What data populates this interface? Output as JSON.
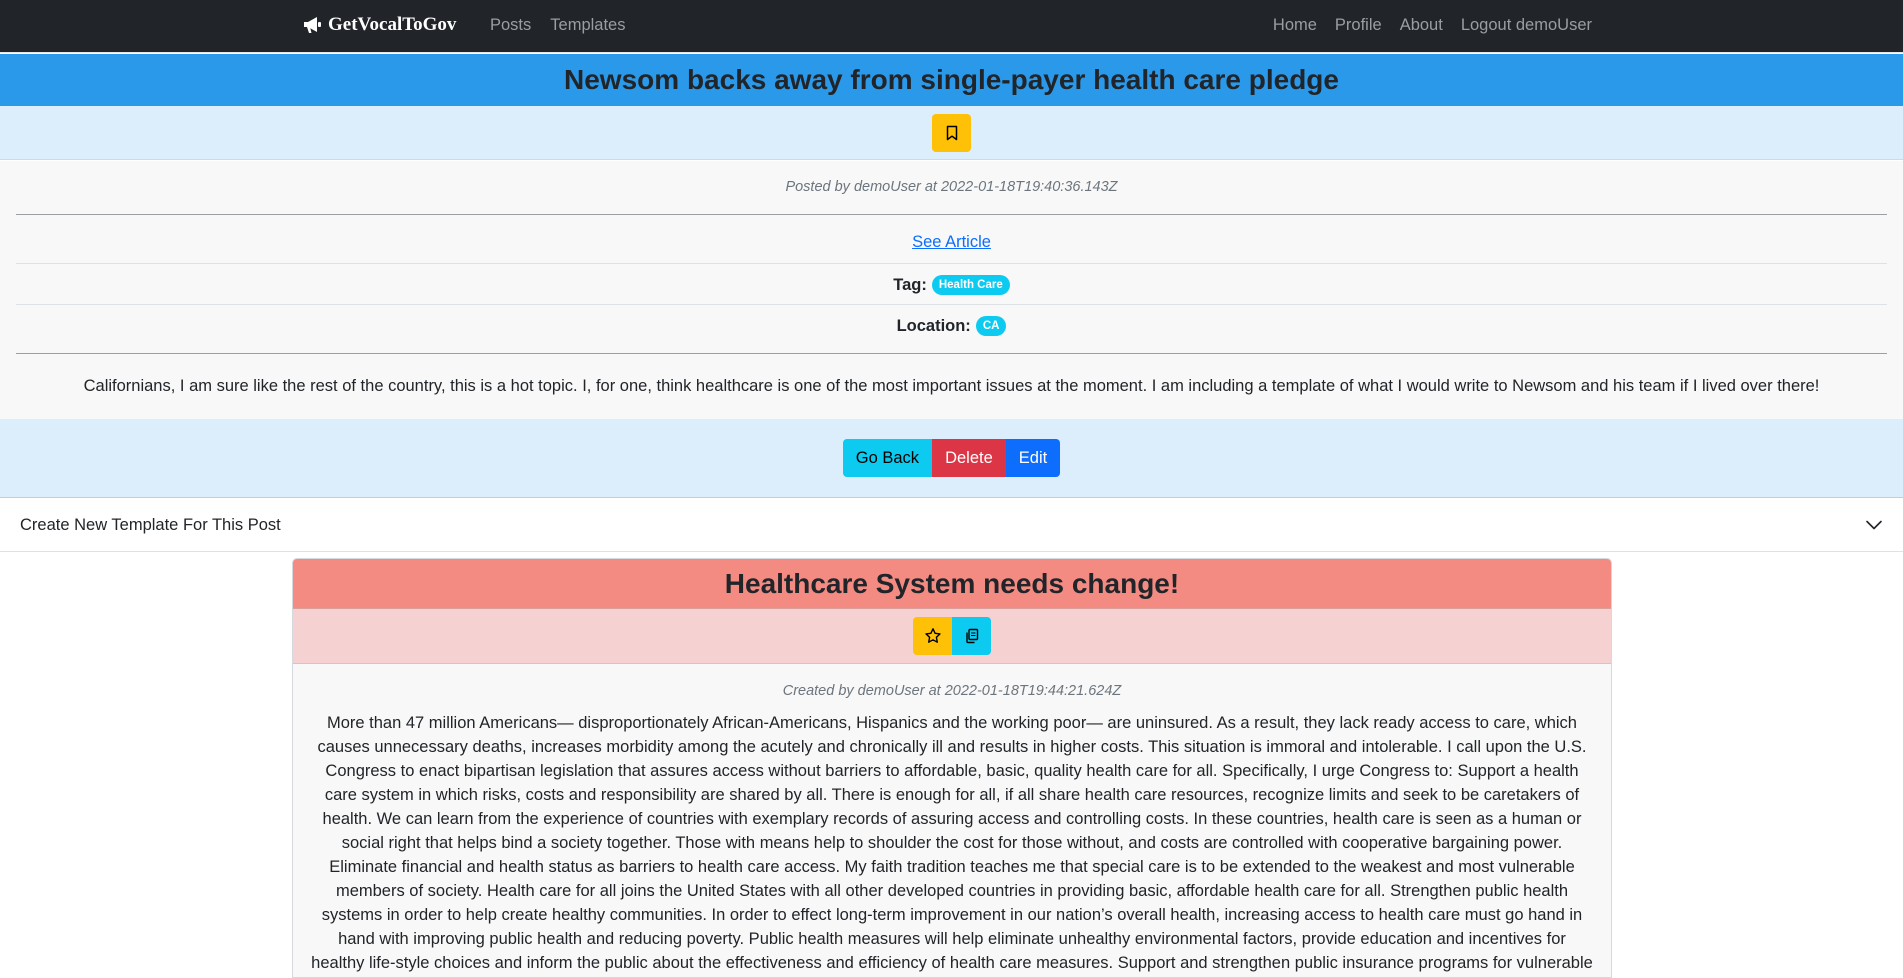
{
  "navbar": {
    "brand": "GetVocalToGov",
    "left_links": [
      "Posts",
      "Templates"
    ],
    "right_links": [
      "Home",
      "Profile",
      "About",
      "Logout demoUser"
    ]
  },
  "post": {
    "title": "Newsom backs away from single-payer health care pledge",
    "meta": "Posted by demoUser at 2022-01-18T19:40:36.143Z",
    "article_link": "See Article",
    "tag_label": "Tag:",
    "tag": "Health Care",
    "location_label": "Location:",
    "location": "CA",
    "description": "Californians, I am sure like the rest of the country, this is a hot topic. I, for one, think healthcare is one of the most important issues at the moment. I am including a template of what I would write to Newsom and his team if I lived over there!",
    "buttons": {
      "go_back": "Go Back",
      "delete": "Delete",
      "edit": "Edit"
    }
  },
  "accordion": {
    "label": "Create New Template For This Post"
  },
  "template_card": {
    "title": "Healthcare System needs change!",
    "meta": "Created by demoUser at 2022-01-18T19:44:21.624Z",
    "body": "More than 47 million Americans— disproportionately African-Americans, Hispanics and the working poor— are uninsured. As a result, they lack ready access to care, which causes unnecessary deaths, increases morbidity among the acutely and chronically ill and results in higher costs. This situation is immoral and intolerable. I call upon the U.S. Congress to enact bipartisan legislation that assures access without barriers to affordable, basic, quality health care for all. Specifically, I urge Congress to: Support a health care system in which risks, costs and responsibility are shared by all. There is enough for all, if all share health care resources, recognize limits and seek to be caretakers of health. We can learn from the experience of countries with exemplary records of assuring access and controlling costs. In these countries, health care is seen as a human or social right that helps bind a society together. Those with means help to shoulder the cost for those without, and costs are controlled with cooperative bargaining power. Eliminate financial and health status as barriers to health care access. My faith tradition teaches me that special care is to be extended to the weakest and most vulnerable members of society. Health care for all joins the United States with all other developed countries in providing basic, affordable health care for all. Strengthen public health systems in order to help create healthy communities. In order to effect long-term improvement in our nation’s overall health, increasing access to health care must go hand in hand with improving public health and reducing poverty. Public health measures will help eliminate unhealthy environmental factors, provide education and incentives for healthy life-style choices and inform the public about the effectiveness and efficiency of health care measures. Support and strengthen public insurance programs for vulnerable populations while comprehensive reform"
  },
  "colors": {
    "navbar": "#212529",
    "post_title_bar": "#2b99ea",
    "light_blue_bar": "#dceefb",
    "card_title_bar": "#f48b82",
    "card_actions_bar": "#f5d1d1",
    "warning": "#ffc107",
    "info": "#0dcaf0",
    "danger": "#dc3545",
    "primary": "#0d6efd"
  },
  "icons": {
    "brand": "megaphone-icon",
    "bookmark": "bookmark-icon",
    "star": "star-icon",
    "copy": "copy-icon",
    "accordion": "chevron-down-icon"
  }
}
